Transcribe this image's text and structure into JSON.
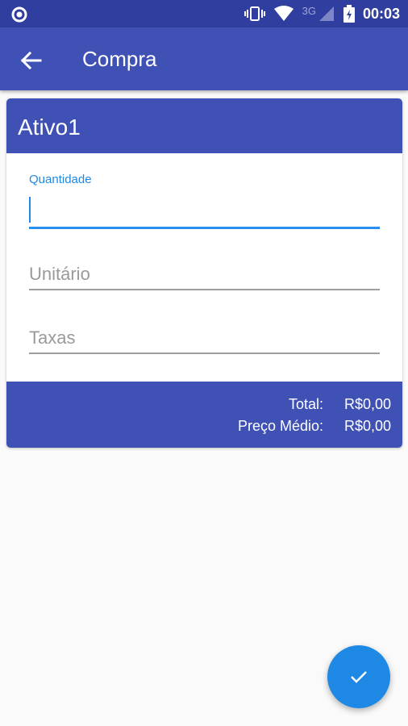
{
  "status_bar": {
    "network_label": "3G",
    "time": "00:03"
  },
  "app_bar": {
    "back_icon": "arrow-left-icon",
    "title": "Compra"
  },
  "card": {
    "asset_name": "Ativo1",
    "fields": {
      "quantidade": {
        "label": "Quantidade",
        "value": ""
      },
      "unitario": {
        "placeholder": "Unitário",
        "value": ""
      },
      "taxas": {
        "placeholder": "Taxas",
        "value": ""
      }
    },
    "summary": {
      "total_label": "Total:",
      "total_value": "R$0,00",
      "avg_label": "Preço Médio:",
      "avg_value": "R$0,00"
    }
  },
  "fab": {
    "icon": "check-icon"
  },
  "colors": {
    "primary": "#3f51b5",
    "primary_dark": "#303f9f",
    "accent": "#1e88e5"
  }
}
